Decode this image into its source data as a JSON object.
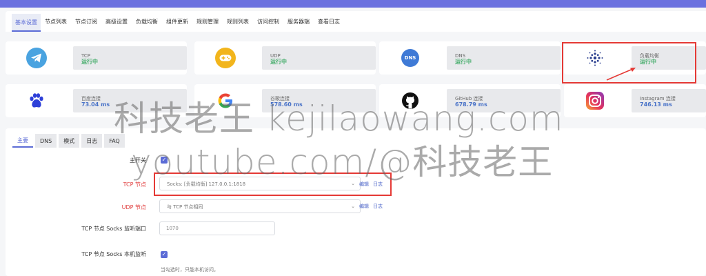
{
  "nav_tabs": [
    "基本设置",
    "节点列表",
    "节点订阅",
    "高级设置",
    "负载均衡",
    "组件更新",
    "规则管理",
    "规则列表",
    "访问控制",
    "服务器端",
    "查看日志"
  ],
  "status_cards": [
    {
      "name": "TCP",
      "status": "运行中",
      "icon": "telegram-icon"
    },
    {
      "name": "UDP",
      "status": "运行中",
      "icon": "gamepad-icon"
    },
    {
      "name": "DNS",
      "status": "运行中",
      "icon": "dns-icon",
      "icon_text": "DNS"
    },
    {
      "name": "负载均衡",
      "status": "运行中",
      "icon": "haproxy-icon"
    },
    {
      "name": "百度连接",
      "status": "73.04 ms",
      "icon": "baidu-paw-icon"
    },
    {
      "name": "谷歌连接",
      "status": "578.60 ms",
      "icon": "google-icon"
    },
    {
      "name": "GitHub 连接",
      "status": "678.79 ms",
      "icon": "github-icon"
    },
    {
      "name": "Instagram 连接",
      "status": "746.13 ms",
      "icon": "instagram-icon"
    }
  ],
  "sub_tabs": [
    "主要",
    "DNS",
    "模式",
    "日志",
    "FAQ"
  ],
  "form": {
    "main_switch_label": "主开关",
    "tcp_label": "TCP 节点",
    "tcp_value": "Socks: [负载均衡] 127.0.0.1:1818",
    "udp_label": "UDP 节点",
    "udp_value": "与 TCP 节点相同",
    "edit_link": "编辑",
    "log_link": "日志",
    "socks_port_label": "TCP 节点 Socks 监听端口",
    "socks_port_value": "1070",
    "socks_local_label": "TCP 节点 Socks 本机监听",
    "socks_local_hint": "当勾选时，只能本机访问。"
  },
  "watermark": {
    "line1": "科技老王 kejilaowang.com",
    "line2": "youtube.com/@科技老王"
  },
  "colors": {
    "accent": "#5b6bd6",
    "running": "#4caf70",
    "latency": "#4a73c8",
    "highlight_red": "#e53935",
    "topbar": "#6b71df"
  }
}
